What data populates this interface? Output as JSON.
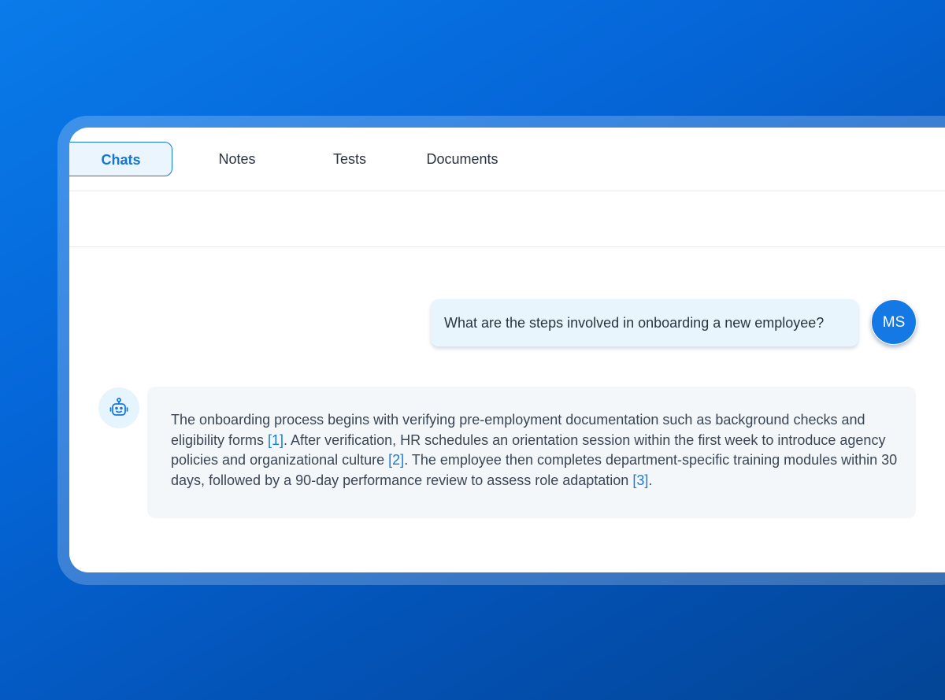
{
  "tabs": [
    {
      "label": "Chats",
      "active": true
    },
    {
      "label": "Notes",
      "active": false
    },
    {
      "label": "Tests",
      "active": false
    },
    {
      "label": "Documents",
      "active": false
    }
  ],
  "chat": {
    "user": {
      "initials": "MS",
      "message": "What are the steps involved in onboarding a new employee?"
    },
    "bot": {
      "icon": "robot-icon",
      "segments": [
        {
          "text": "The onboarding process begins with verifying pre-employment documentation such as background checks and eligibility forms "
        },
        {
          "cite": "[1]"
        },
        {
          "text": ". After verification, HR schedules an orientation session within the first week to introduce agency policies and organizational culture "
        },
        {
          "cite": "[2]"
        },
        {
          "text": ". The employee then completes department-specific training modules within 30 days, followed by a 90-day performance review to assess role adaptation "
        },
        {
          "cite": "[3]"
        },
        {
          "text": "."
        }
      ]
    }
  },
  "colors": {
    "accent": "#1376d2",
    "avatar": "#1479e5",
    "user_bubble": "#e9f5fd",
    "bot_bubble": "#f3f7fa",
    "background_gradient_start": "#0a7bea",
    "background_gradient_end": "#034596"
  }
}
